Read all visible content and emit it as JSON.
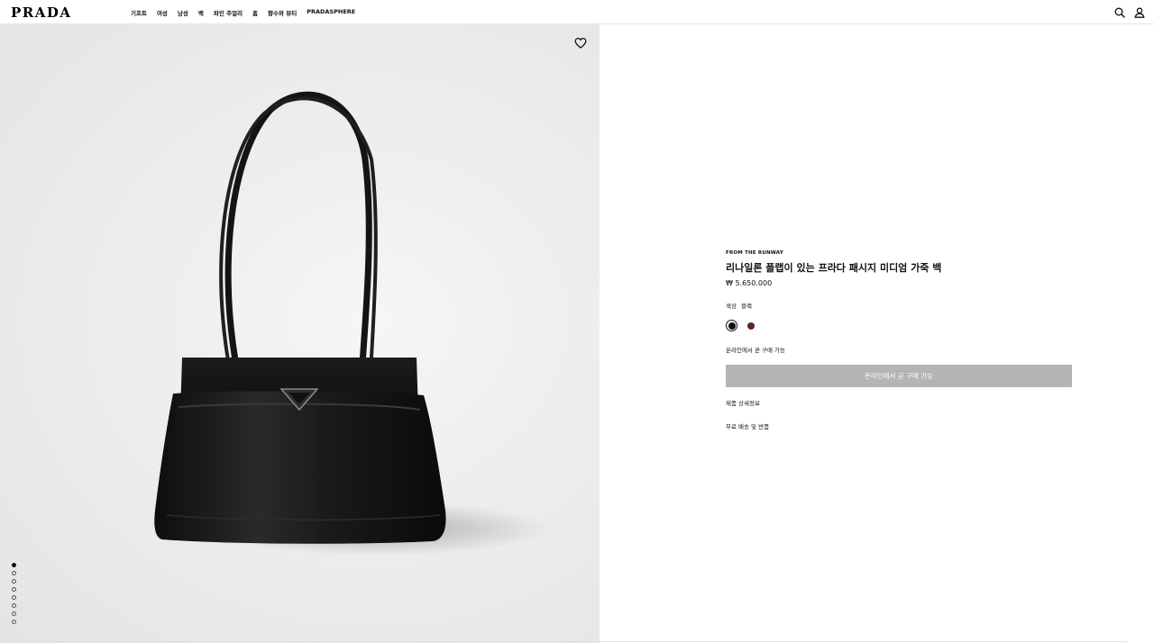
{
  "header": {
    "logo": "PRADA",
    "nav": [
      "기프트",
      "여성",
      "남성",
      "백",
      "파인 주얼리",
      "홈",
      "향수와 뷰티",
      "PRADASPHERE"
    ],
    "icons": [
      "search-icon",
      "account-icon"
    ]
  },
  "gallery": {
    "favorite_icon": "heart-icon",
    "image_count": 9,
    "active_index": 0
  },
  "product": {
    "eyebrow": "FROM THE RUNWAY",
    "title": "리나일론 플랩이 있는 프라다 패시지 미디엄 가죽 백",
    "price": "₩ 5.650.000",
    "color_label": "색상",
    "color_value": "블랙",
    "swatches": [
      {
        "name": "black",
        "color": "#111111",
        "selected": true
      },
      {
        "name": "brown",
        "color": "#5a2a22",
        "selected": false
      }
    ],
    "availability": "온라인에서 곧 구매 가능",
    "cta_label": "온라인에서 곧 구매 가능",
    "details_link": "제품 상세정보",
    "shipping_link": "무료 배송 및 반품"
  },
  "colors": {
    "cta_bg": "#b4b4b4",
    "page_bg": "#ffffff",
    "image_bg": "#ececec"
  }
}
